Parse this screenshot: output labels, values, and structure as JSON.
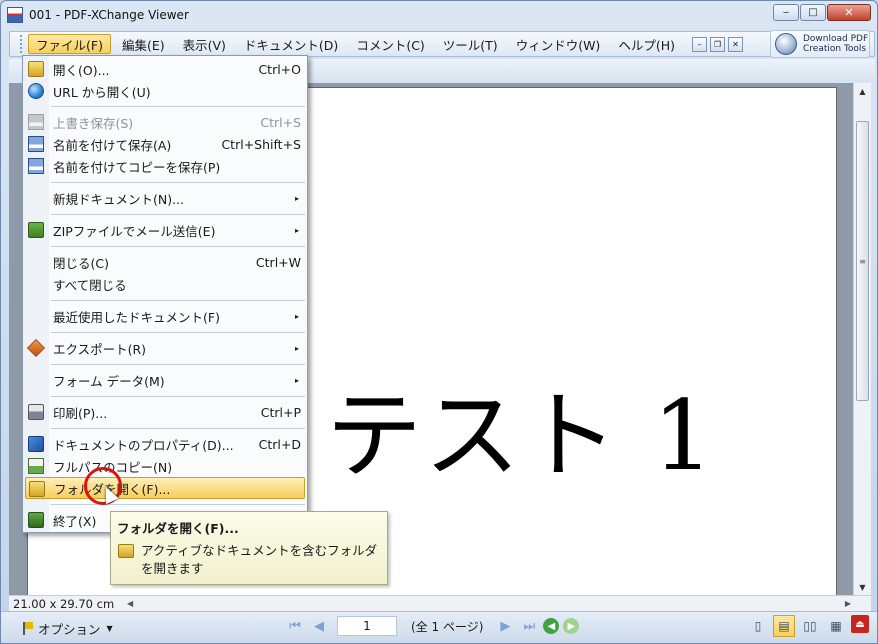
{
  "window": {
    "title": "001 - PDF-XChange Viewer",
    "controls": {
      "minimize": "‒",
      "maximize": "□",
      "close": "✕"
    }
  },
  "menubar": {
    "items": [
      "ファイル(F)",
      "編集(E)",
      "表示(V)",
      "ドキュメント(D)",
      "コメント(C)",
      "ツール(T)",
      "ウィンドウ(W)",
      "ヘルプ(H)"
    ],
    "active_index": 0,
    "mdi_buttons": [
      "–",
      "❐",
      "✕"
    ],
    "download_label_line1": "Download PDF",
    "download_label_line2": "Creation Tools"
  },
  "document": {
    "page_text": "テスト 1",
    "page_size": "21.00 x 29.70 cm"
  },
  "file_menu": {
    "items": [
      {
        "label": "開く(O)...",
        "shortcut": "Ctrl+O",
        "icon": "open-folder-icon"
      },
      {
        "label": "URL から開く(U)",
        "shortcut": "",
        "icon": "globe-icon"
      },
      {
        "label": "上書き保存(S)",
        "shortcut": "Ctrl+S",
        "icon": "save-disk-icon",
        "disabled": true
      },
      {
        "label": "名前を付けて保存(A)",
        "shortcut": "Ctrl+Shift+S",
        "icon": "save-as-disk-icon"
      },
      {
        "label": "名前を付けてコピーを保存(P)",
        "shortcut": "",
        "icon": "save-copy-disk-icon"
      },
      {
        "label": "新規ドキュメント(N)...",
        "shortcut": "",
        "submenu": true
      },
      {
        "label": "ZIPファイルでメール送信(E)",
        "shortcut": "",
        "icon": "zip-mail-icon",
        "submenu": true
      },
      {
        "label": "閉じる(C)",
        "shortcut": "Ctrl+W"
      },
      {
        "label": "すべて閉じる",
        "shortcut": ""
      },
      {
        "label": "最近使用したドキュメント(F)",
        "shortcut": "",
        "submenu": true
      },
      {
        "label": "エクスポート(R)",
        "shortcut": "",
        "icon": "export-icon",
        "submenu": true
      },
      {
        "label": "フォーム データ(M)",
        "shortcut": "",
        "submenu": true
      },
      {
        "label": "印刷(P)...",
        "shortcut": "Ctrl+P",
        "icon": "printer-icon"
      },
      {
        "label": "ドキュメントのプロパティ(D)...",
        "shortcut": "Ctrl+D",
        "icon": "properties-icon"
      },
      {
        "label": "フルパスのコピー(N)",
        "shortcut": "",
        "icon": "copy-path-icon"
      },
      {
        "label": "フォルダを開く(F)...",
        "shortcut": "",
        "icon": "open-folder-icon",
        "highlighted": true
      },
      {
        "label": "終了(X)",
        "shortcut": "",
        "icon": "exit-icon"
      }
    ],
    "submenu_arrow": "▸"
  },
  "tooltip": {
    "title": "フォルダを開く(F)...",
    "description": "アクティブなドキュメントを含むフォルダを開きます"
  },
  "statusbar": {
    "options_label": "オプション",
    "current_page": "1",
    "page_total": "(全 1 ページ)",
    "nav_first": "⏮",
    "nav_prev": "◀",
    "nav_next": "▶",
    "nav_last": "⏭"
  },
  "colors": {
    "menu_highlight": "#f8cf5a",
    "window_frame": "#c3d4ea",
    "tooltip_bg": "#f1f1cd",
    "click_circle": "#e01010"
  }
}
